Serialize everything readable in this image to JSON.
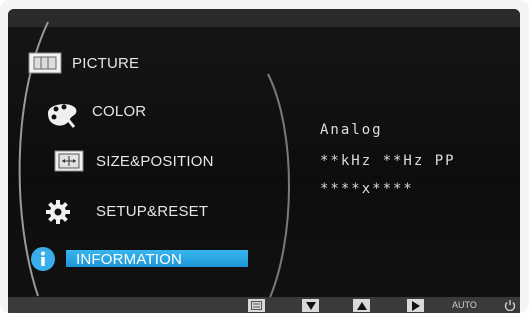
{
  "menu": {
    "items": [
      {
        "label": "PICTURE",
        "icon": "picture-icon",
        "active": false
      },
      {
        "label": "COLOR",
        "icon": "palette-icon",
        "active": false
      },
      {
        "label": "SIZE&POSITION",
        "icon": "size-position-icon",
        "active": false
      },
      {
        "label": "SETUP&RESET",
        "icon": "gear-icon",
        "active": false
      },
      {
        "label": "INFORMATION",
        "icon": "info-icon",
        "active": true
      }
    ]
  },
  "information": {
    "signal": "Analog",
    "frequency": "**kHz **Hz PP",
    "resolution": "****x****"
  },
  "bottom_bar": {
    "buttons": [
      "menu-button",
      "down-button",
      "up-button",
      "enter-button"
    ],
    "auto_label": "AUTO",
    "power_icon": "power-icon"
  },
  "colors": {
    "highlight": "#2aa6e6",
    "background": "#111111",
    "text": "#e6e6e6"
  }
}
